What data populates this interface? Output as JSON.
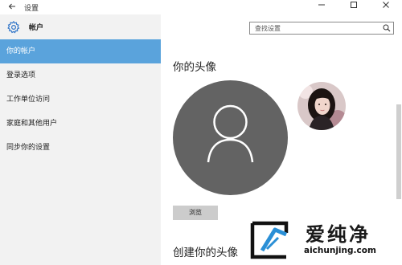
{
  "window": {
    "title": "设置",
    "back_icon": "back-arrow-icon",
    "controls": [
      "minimize-icon",
      "maximize-icon",
      "close-icon"
    ]
  },
  "sidebar": {
    "section_title": "帐户",
    "icon": "gear-icon",
    "items": [
      {
        "label": "你的帐户",
        "active": true
      },
      {
        "label": "登录选项",
        "active": false
      },
      {
        "label": "工作单位访问",
        "active": false
      },
      {
        "label": "家庭和其他用户",
        "active": false
      },
      {
        "label": "同步你的设置",
        "active": false
      }
    ]
  },
  "search": {
    "placeholder": "查找设置",
    "icon": "search-icon"
  },
  "main": {
    "heading": "你的头像",
    "browse_label": "浏览",
    "heading2": "创建你的头像"
  },
  "watermark": {
    "brand": "爱纯净",
    "domain": "aichunjing.com"
  },
  "colors": {
    "accent": "#5aa3dc",
    "sidebar_bg": "#f2f2f2",
    "avatar_bg": "#636363"
  }
}
